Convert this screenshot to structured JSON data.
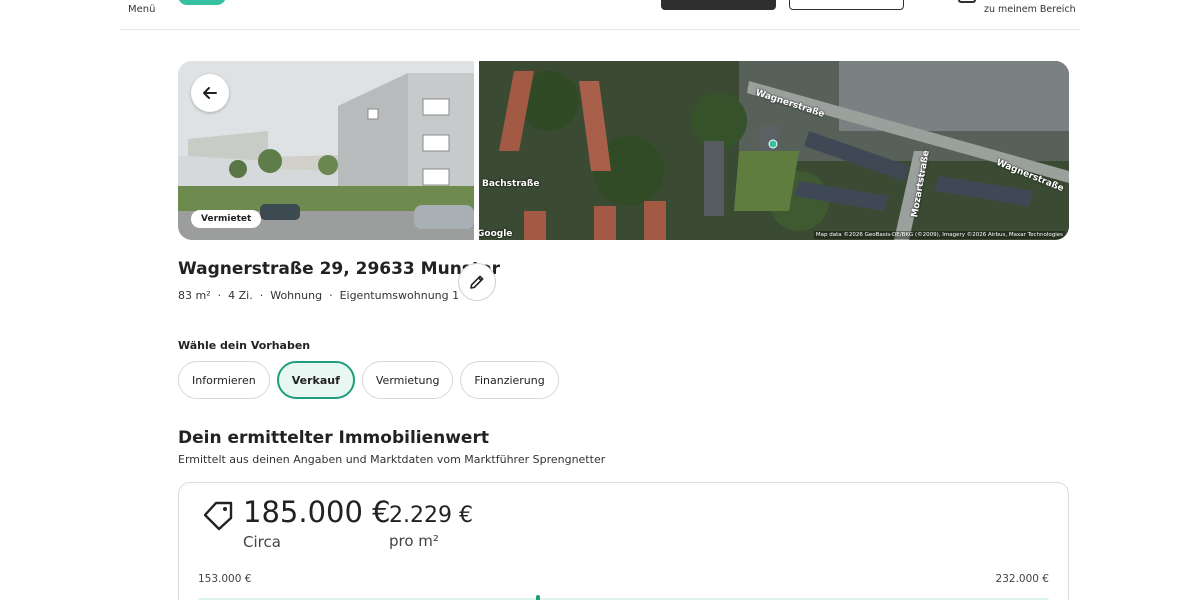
{
  "header": {
    "menu_label": "Menü",
    "area_label": "zu meinem Bereich"
  },
  "gallery": {
    "status_badge": "Vermietet",
    "map_streets": [
      "Wagnerstraße",
      "Wagnerstraße",
      "Bachstraße",
      "Mozartstraße"
    ],
    "google_mark": "Google",
    "map_attribution": "Map data ©2026 GeoBasis-DE/BKG (©2009), Imagery ©2026 Airbus, Maxar Technologies"
  },
  "property": {
    "address": "Wagnerstraße 29, 29633 Munster",
    "facts": [
      "83 m²",
      "4 Zi.",
      "Wohnung",
      "Eigentumswohnung 1"
    ]
  },
  "intent": {
    "label": "Wähle dein Vorhaben",
    "options": [
      "Informieren",
      "Verkauf",
      "Vermietung",
      "Finanzierung"
    ],
    "selected": "Verkauf"
  },
  "valuation": {
    "title": "Dein ermittelter Immobilienwert",
    "subtitle": "Ermittelt aus deinen Angaben und Marktdaten vom Marktführer Sprengnetter",
    "price": "185.000 €",
    "price_caption": "Circa",
    "per_sqm": "2.229 €",
    "per_sqm_caption": "pro m²",
    "range_min": "153.000 €",
    "range_max": "232.000 €",
    "range_position": 0.4
  },
  "colors": {
    "accent": "#1e9e7e",
    "accent_light": "#e9f7f2",
    "brand": "#35c0a0"
  }
}
